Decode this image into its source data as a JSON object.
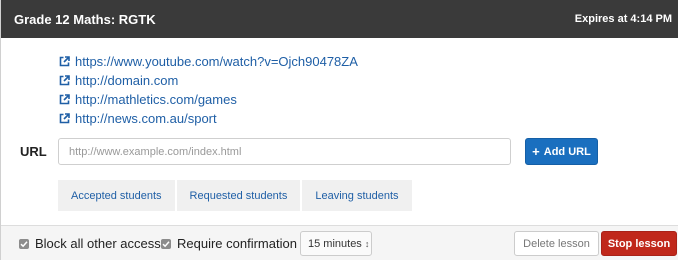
{
  "header": {
    "title": "Grade 12 Maths: RGTK",
    "expires": "Expires at 4:14 PM"
  },
  "links": [
    {
      "icon": "external-link-icon",
      "url": "https://www.youtube.com/watch?v=Ojch90478ZA"
    },
    {
      "icon": "external-link-icon",
      "url": "http://domain.com"
    },
    {
      "icon": "external-link-icon",
      "url": "http://mathletics.com/games"
    },
    {
      "icon": "external-link-icon",
      "url": "http://news.com.au/sport"
    }
  ],
  "url_form": {
    "label": "URL",
    "placeholder": "http://www.example.com/index.html",
    "value": "",
    "add_button_icon": "plus-icon",
    "add_button_label": "Add URL"
  },
  "tabs": [
    {
      "label": "Accepted students"
    },
    {
      "label": "Requested students"
    },
    {
      "label": "Leaving students"
    }
  ],
  "footer": {
    "block_label": "Block all other access",
    "block_checked": true,
    "confirm_label": "Require confirmation",
    "confirm_checked": true,
    "duration_selected": "15 minutes",
    "delete_label": "Delete lesson",
    "stop_label": "Stop lesson"
  },
  "colors": {
    "header_bg": "#3a3a3a",
    "link": "#1f5fa6",
    "primary_button": "#1a6fbf",
    "danger_button": "#c0281b"
  }
}
